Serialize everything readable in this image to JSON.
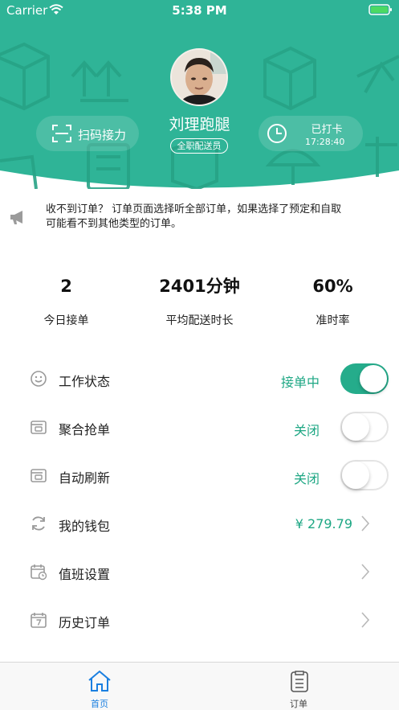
{
  "status_bar": {
    "carrier": "Carrier",
    "time": "5:38 PM"
  },
  "theme": {
    "accent": "#25ac8b",
    "header_bg": "#2fb497",
    "tab_active": "#1a7fe0"
  },
  "profile": {
    "name": "刘理跑腿",
    "role": "全职配送员"
  },
  "scan_button": {
    "label": "扫码接力",
    "icon": "scan-icon"
  },
  "clock_in": {
    "status": "已打卡",
    "time": "17:28:40",
    "icon": "clock-icon"
  },
  "notice": {
    "icon": "megaphone-icon",
    "text": "收不到订单？ 订单页面选择听全部订单，如果选择了预定和自取可能看不到其他类型的订单。"
  },
  "stats": [
    {
      "value": "2",
      "label": "今日接单"
    },
    {
      "value": "2401分钟",
      "label": "平均配送时长"
    },
    {
      "value": "60%",
      "label": "准时率"
    }
  ],
  "menu": [
    {
      "icon": "smiley-icon",
      "label": "工作状态",
      "value": "接单中",
      "toggle": "on"
    },
    {
      "icon": "wallet-icon",
      "label": "聚合抢单",
      "value": "关闭",
      "toggle": "off"
    },
    {
      "icon": "wallet-icon",
      "label": "自动刷新",
      "value": "关闭",
      "toggle": "off"
    },
    {
      "icon": "refresh-icon",
      "label": "我的钱包",
      "value": "¥ 279.79"
    },
    {
      "icon": "calendar-clock-icon",
      "label": "值班设置",
      "value": ""
    },
    {
      "icon": "calendar-icon",
      "label": "历史订单",
      "value": ""
    }
  ],
  "tabs": [
    {
      "label": "首页",
      "icon": "home-icon",
      "active": true
    },
    {
      "label": "订单",
      "icon": "clipboard-icon",
      "active": false
    }
  ]
}
